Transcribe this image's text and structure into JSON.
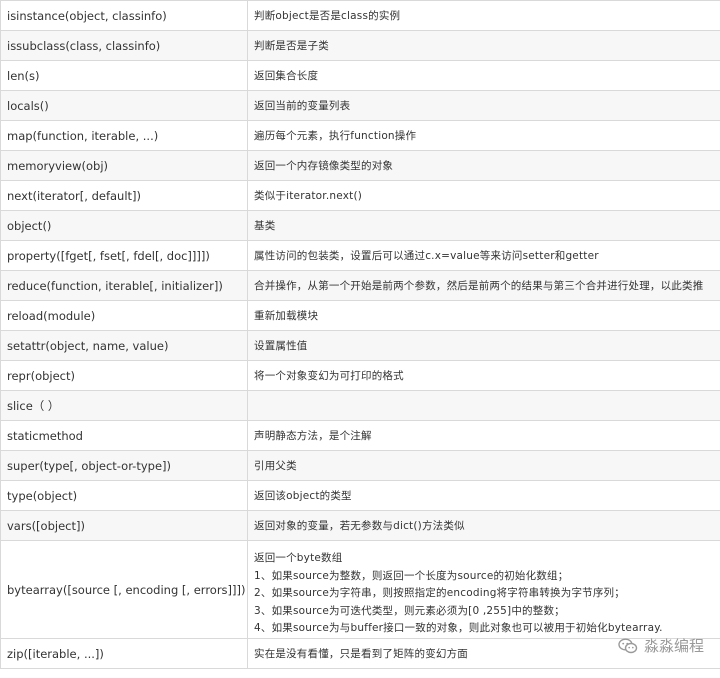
{
  "rows": [
    {
      "func": "isinstance(object, classinfo)",
      "desc": "判断object是否是class的实例"
    },
    {
      "func": "issubclass(class, classinfo)",
      "desc": "判断是否是子类"
    },
    {
      "func": "len(s)",
      "desc": "返回集合长度"
    },
    {
      "func": "locals()",
      "desc": "返回当前的变量列表"
    },
    {
      "func": "map(function, iterable, ...)",
      "desc": "遍历每个元素，执行function操作"
    },
    {
      "func": "memoryview(obj)",
      "desc": "返回一个内存镜像类型的对象"
    },
    {
      "func": "next(iterator[, default])",
      "desc": "类似于iterator.next()"
    },
    {
      "func": "object()",
      "desc": "基类"
    },
    {
      "func": "property([fget[, fset[, fdel[, doc]]]])",
      "desc": "属性访问的包装类，设置后可以通过c.x=value等来访问setter和getter"
    },
    {
      "func": "reduce(function, iterable[, initializer])",
      "desc": "合并操作，从第一个开始是前两个参数，然后是前两个的结果与第三个合并进行处理，以此类推"
    },
    {
      "func": "reload(module)",
      "desc": "重新加载模块"
    },
    {
      "func": "setattr(object, name, value)",
      "desc": "设置属性值"
    },
    {
      "func": "repr(object)",
      "desc": "将一个对象变幻为可打印的格式"
    },
    {
      "func": "slice（ ）",
      "desc": ""
    },
    {
      "func": "staticmethod",
      "desc": "声明静态方法，是个注解"
    },
    {
      "func": "super(type[, object-or-type])",
      "desc": "引用父类"
    },
    {
      "func": "type(object)",
      "desc": "返回该object的类型"
    },
    {
      "func": "vars([object])",
      "desc": "返回对象的变量，若无参数与dict()方法类似"
    }
  ],
  "bytearray_row": {
    "func": "bytearray([source [, encoding [, errors]]])",
    "lines": [
      "返回一个byte数组",
      "1、如果source为整数，则返回一个长度为source的初始化数组；",
      "2、如果source为字符串，则按照指定的encoding将字符串转换为字节序列；",
      "3、如果source为可迭代类型，则元素必须为[0 ,255]中的整数；",
      "4、如果source为与buffer接口一致的对象，则此对象也可以被用于初始化bytearray."
    ]
  },
  "last_row": {
    "func": "zip([iterable, ...])",
    "desc": "实在是没有看懂，只是看到了矩阵的变幻方面"
  },
  "watermark": {
    "text": "淼淼编程",
    "icon": "wechat-logo-icon"
  }
}
